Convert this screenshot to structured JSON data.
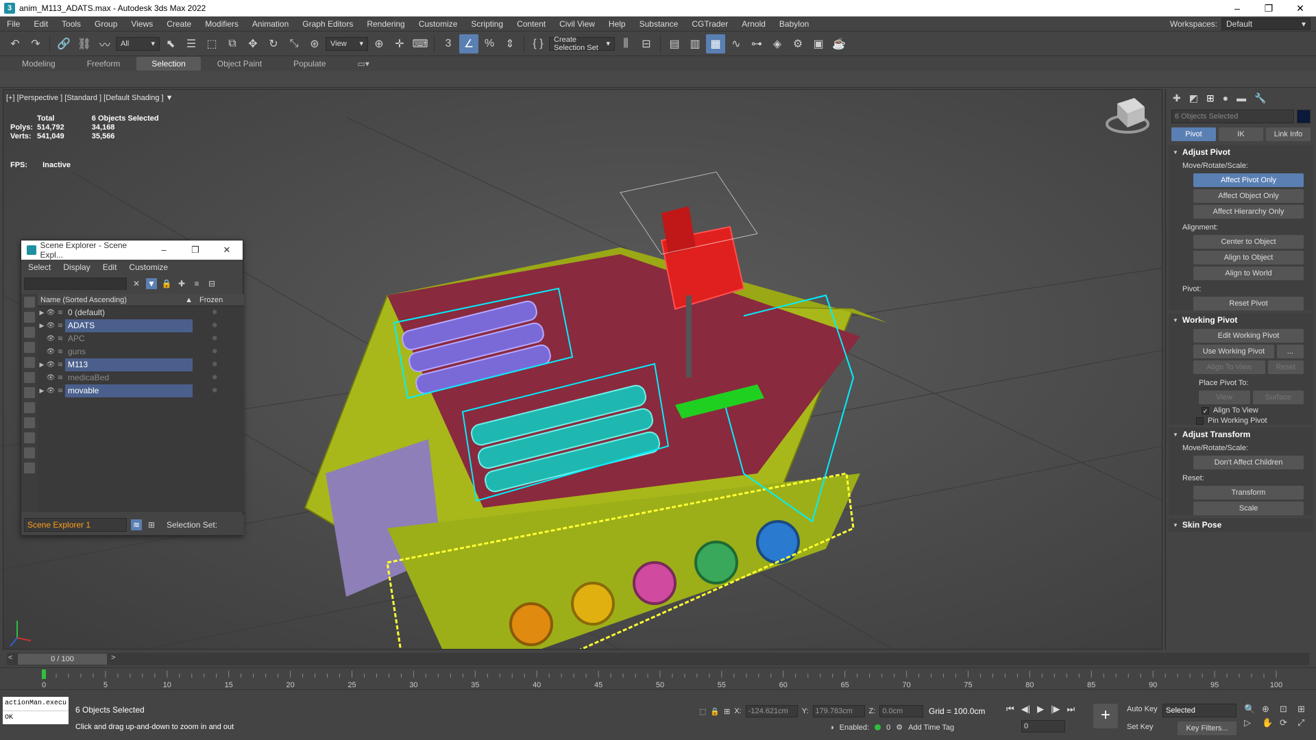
{
  "window": {
    "title": "anim_M113_ADATS.max - Autodesk 3ds Max 2022",
    "minimize": "–",
    "maximize": "❐",
    "close": "✕"
  },
  "menu": [
    "File",
    "Edit",
    "Tools",
    "Group",
    "Views",
    "Create",
    "Modifiers",
    "Animation",
    "Graph Editors",
    "Rendering",
    "Customize",
    "Scripting",
    "Content",
    "Civil View",
    "Help",
    "Substance",
    "CGTrader",
    "Arnold",
    "Babylon"
  ],
  "workspaces": {
    "label": "Workspaces:",
    "value": "Default"
  },
  "toolbar": {
    "filter": "All",
    "ref_coord": "View",
    "selection_set": "Create Selection Set"
  },
  "ribbon": {
    "tabs": [
      "Modeling",
      "Freeform",
      "Selection",
      "Object Paint",
      "Populate"
    ],
    "selected": "Selection"
  },
  "viewport": {
    "label": "[+] [Perspective ] [Standard ] [Default Shading ]",
    "stats": {
      "total_label": "Total",
      "selected_label": "6 Objects Selected",
      "polys_label": "Polys:",
      "polys_total": "514,792",
      "polys_sel": "34,168",
      "verts_label": "Verts:",
      "verts_total": "541,049",
      "verts_sel": "35,566",
      "fps_label": "FPS:",
      "fps_value": "Inactive"
    }
  },
  "scene_explorer": {
    "title": "Scene Explorer - Scene Expl...",
    "menu": [
      "Select",
      "Display",
      "Edit",
      "Customize"
    ],
    "col_name": "Name (Sorted Ascending)",
    "col_frozen": "Frozen",
    "rows": [
      {
        "name": "0 (default)",
        "selected": false,
        "dim": false,
        "arrow": "▶"
      },
      {
        "name": "ADATS",
        "selected": true,
        "dim": false,
        "arrow": "▶"
      },
      {
        "name": "APC",
        "selected": false,
        "dim": true,
        "arrow": ""
      },
      {
        "name": "guns",
        "selected": false,
        "dim": true,
        "arrow": ""
      },
      {
        "name": "M113",
        "selected": true,
        "dim": false,
        "arrow": "▶"
      },
      {
        "name": "medicaBed",
        "selected": false,
        "dim": true,
        "arrow": ""
      },
      {
        "name": "movable",
        "selected": true,
        "dim": false,
        "arrow": "▶"
      }
    ],
    "footer_name": "Scene Explorer 1",
    "selection_set_label": "Selection Set:"
  },
  "command_panel": {
    "name_field": "6 Objects Selected",
    "tabs": [
      "Pivot",
      "IK",
      "Link Info"
    ],
    "adjust_pivot": {
      "title": "Adjust Pivot",
      "mrs_label": "Move/Rotate/Scale:",
      "buttons": [
        "Affect Pivot Only",
        "Affect Object Only",
        "Affect Hierarchy Only"
      ],
      "alignment_label": "Alignment:",
      "align_buttons": [
        "Center to Object",
        "Align to Object",
        "Align to World"
      ],
      "pivot_label": "Pivot:",
      "reset_pivot": "Reset Pivot"
    },
    "working_pivot": {
      "title": "Working Pivot",
      "edit": "Edit Working Pivot",
      "use": "Use Working Pivot",
      "use_more": "...",
      "align_to_view": "Align To View",
      "reset": "Reset",
      "place_label": "Place Pivot To:",
      "view": "View",
      "surface": "Surface",
      "chk_align": "Align To View",
      "chk_align_mark": "✓",
      "chk_pin": "Pin Working Pivot"
    },
    "adjust_transform": {
      "title": "Adjust Transform",
      "mrs_label": "Move/Rotate/Scale:",
      "dont_affect": "Don't Affect Children",
      "reset_label": "Reset:",
      "transform": "Transform",
      "scale": "Scale"
    },
    "skin_pose": {
      "title": "Skin Pose"
    }
  },
  "timeline": {
    "frame_display": "0 / 100",
    "prev": "<",
    "next": ">",
    "ticks": [
      "0",
      "5",
      "10",
      "15",
      "20",
      "25",
      "30",
      "35",
      "40",
      "45",
      "50",
      "55",
      "60",
      "65",
      "70",
      "75",
      "80",
      "85",
      "90",
      "95",
      "100"
    ]
  },
  "status": {
    "script_line1": "actionMan.execu",
    "script_line2": "OK",
    "msg1": "6 Objects Selected",
    "msg2": "Click and drag up-and-down to zoom in and out",
    "x_label": "X:",
    "x_value": "-124.621cm",
    "y_label": "Y:",
    "y_value": "179.783cm",
    "z_label": "Z:",
    "z_value": "0.0cm",
    "grid": "Grid = 100.0cm",
    "enabled_label": "Enabled:",
    "enabled_value": "0",
    "add_time_tag": "Add Time Tag",
    "frame_value": "0",
    "auto_key": "Auto Key",
    "set_key": "Set Key",
    "selected_drop": "Selected",
    "key_filters": "Key Filters..."
  }
}
